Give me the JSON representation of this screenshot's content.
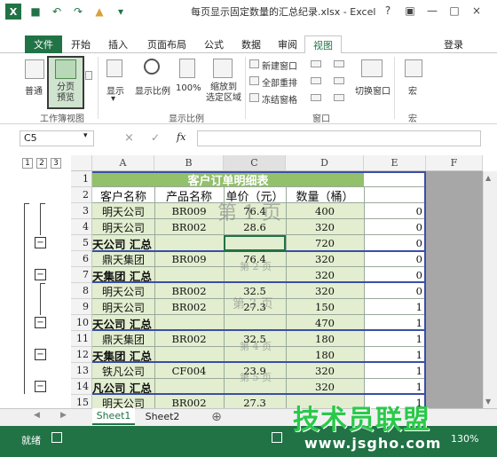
{
  "window": {
    "title": "每页显示固定数量的汇总纪录.xlsx - Excel",
    "app_logo": "X",
    "help": "?",
    "minimize": "—",
    "close": "×"
  },
  "ribbon_tabs": {
    "file": "文件",
    "items": [
      "开始",
      "插入",
      "页面布局",
      "公式",
      "数据",
      "审阅"
    ],
    "active": "视图",
    "login": "登录"
  },
  "ribbon": {
    "normal": "普通",
    "page_break_preview": [
      "分页",
      "预览"
    ],
    "group_workbook_views": "工作簿视图",
    "show": "显示",
    "zoom": "显示比例",
    "zoom_100": "100%",
    "zoom_selection": [
      "缩放到",
      "选定区域"
    ],
    "group_zoom": "显示比例",
    "new_window": "新建窗口",
    "arrange_all": "全部重排",
    "freeze_panes": "冻结窗格",
    "switch_window": "切换窗口",
    "macros": "宏",
    "group_window": "窗口",
    "group_macros": "宏"
  },
  "formula_bar": {
    "name_box": "C5",
    "cancel": "×",
    "enter": "✓",
    "fx": "fx"
  },
  "outline_levels": [
    "1",
    "2",
    "3"
  ],
  "columns": [
    "A",
    "B",
    "C",
    "D",
    "E",
    "F"
  ],
  "rows": [
    {
      "num": "1",
      "a": "客户订单明细表",
      "b": "",
      "c": "",
      "d": "",
      "e": ""
    },
    {
      "num": "2",
      "a": "客户名称",
      "b": "产品名称",
      "c": "单价（元）",
      "d": "数量（桶）",
      "e": ""
    },
    {
      "num": "3",
      "a": "明天公司",
      "b": "BR009",
      "c": "76.4",
      "d": "400",
      "e": "0"
    },
    {
      "num": "4",
      "a": "明天公司",
      "b": "BR002",
      "c": "28.6",
      "d": "320",
      "e": "0"
    },
    {
      "num": "5",
      "a": "天公司 汇总",
      "b": "",
      "c": "",
      "d": "720",
      "e": "0"
    },
    {
      "num": "6",
      "a": "鼎天集团",
      "b": "BR009",
      "c": "76.4",
      "d": "320",
      "e": "0"
    },
    {
      "num": "7",
      "a": "天集团 汇总",
      "b": "",
      "c": "",
      "d": "320",
      "e": "0"
    },
    {
      "num": "8",
      "a": "明天公司",
      "b": "BR002",
      "c": "32.5",
      "d": "320",
      "e": "0"
    },
    {
      "num": "9",
      "a": "明天公司",
      "b": "BR002",
      "c": "27.3",
      "d": "150",
      "e": "1"
    },
    {
      "num": "10",
      "a": "天公司 汇总",
      "b": "",
      "c": "",
      "d": "470",
      "e": "1"
    },
    {
      "num": "11",
      "a": "鼎天集团",
      "b": "BR002",
      "c": "32.5",
      "d": "180",
      "e": "1"
    },
    {
      "num": "12",
      "a": "天集团 汇总",
      "b": "",
      "c": "",
      "d": "180",
      "e": "1"
    },
    {
      "num": "13",
      "a": "铁凡公司",
      "b": "CF004",
      "c": "23.9",
      "d": "320",
      "e": "1"
    },
    {
      "num": "14",
      "a": "凡公司 汇总",
      "b": "",
      "c": "",
      "d": "320",
      "e": "1"
    },
    {
      "num": "15",
      "a": "明天公司",
      "b": "BR002",
      "c": "27.3",
      "d": "",
      "e": "1"
    }
  ],
  "page_marks": [
    "第 1 页",
    "第 2 页",
    "第 3 页",
    "第 4 页",
    "第 5 页"
  ],
  "sheets": {
    "tabs": [
      "Sheet1",
      "Sheet2"
    ],
    "active": "Sheet1",
    "add": "⊕"
  },
  "status": {
    "ready": "就绪",
    "zoom": "130%"
  },
  "watermark": {
    "brand": "技术员联盟",
    "url": "www.jsgho.com"
  },
  "colors": {
    "excel_green": "#217346",
    "header_fill": "#92c06b",
    "data_fill": "#e2eecf",
    "page_border": "#3a4fa6",
    "gray_area": "#a7a7a7"
  }
}
